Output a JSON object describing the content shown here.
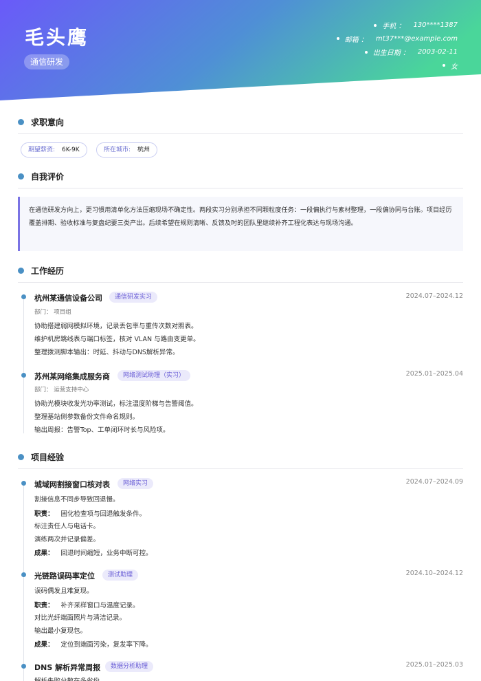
{
  "profile": {
    "name": "毛头鹰",
    "role": "通信研发",
    "contacts": [
      {
        "label": "手机 ：",
        "value": "130****1387"
      },
      {
        "label": "邮箱 ：",
        "value": "mt37***@example.com"
      },
      {
        "label": "出生日期 ：",
        "value": "2003-02-11"
      },
      {
        "label": "",
        "value": "女"
      }
    ]
  },
  "colors": {
    "accent": "#4a90c4",
    "gradient_start": "#6a5af9",
    "gradient_end": "#4ad69a",
    "tag_text": "#6b5fd6"
  },
  "sections": {
    "intent": "求职意向",
    "summary": "自我评价",
    "work": "工作经历",
    "projects": "项目经验"
  },
  "intent": {
    "salary_label": "期望薪资:",
    "salary_value": "6K-9K",
    "city_label": "所在城市:",
    "city_value": "杭州"
  },
  "summary_text": "在通信研发方向上，更习惯用清单化方法压缩现场不确定性。两段实习分别承担不同颗粒度任务：一段偏执行与素材整理，一段偏协同与台账。项目经历覆盖排期、验收标准与复盘纪要三类产出。后续希望在规则清晰、反馈及时的团队里继续补齐工程化表达与现场沟通。",
  "work": [
    {
      "company": "杭州某通信设备公司",
      "tag": "通信研发实习",
      "date": "2024.07–2024.12",
      "dept": "部门：  项目组",
      "lines": [
        "协助搭建弱网模拟环境，记录丢包率与重传次数对照表。",
        "维护机房跳线表与端口标签，核对 VLAN 与路由变更单。",
        "整理拨测脚本输出：时延、抖动与DNS解析异常。"
      ]
    },
    {
      "company": "苏州某网络集成服务商",
      "tag": "网络测试助理（实习）",
      "date": "2025.01–2025.04",
      "dept": "部门：  运营支持中心",
      "lines": [
        "协助光模块收发光功率测试，标注温度阶梯与告警阈值。",
        "整理基站侧参数备份文件命名规则。",
        "输出周报：告警Top、工单闭环时长与风险项。"
      ]
    }
  ],
  "projects": [
    {
      "name": "城域网割接窗口核对表",
      "tag": "网络实习",
      "date": "2024.07–2024.09",
      "desc": "割接信息不同步导致回退慢。",
      "duty_label": "职责：",
      "duties": [
        "固化检查项与回退触发条件。",
        "标注责任人与电话卡。",
        "演练两次并记录偏差。"
      ],
      "result_label": "成果：",
      "result": "回退时间缩短，业务中断可控。"
    },
    {
      "name": "光链路误码率定位",
      "tag": "测试助理",
      "date": "2024.10–2024.12",
      "desc": "误码偶发且难复现。",
      "duty_label": "职责：",
      "duties": [
        "补齐采样窗口与温度记录。",
        "对比光纤端面照片与清洁记录。",
        "输出最小复现包。"
      ],
      "result_label": "成果：",
      "result": "定位到端面污染，复发率下降。"
    },
    {
      "name": "DNS 解析异常周报",
      "tag": "数据分析助理",
      "date": "2025.01–2025.03",
      "desc": "解析失败分散在多省份。"
    }
  ]
}
